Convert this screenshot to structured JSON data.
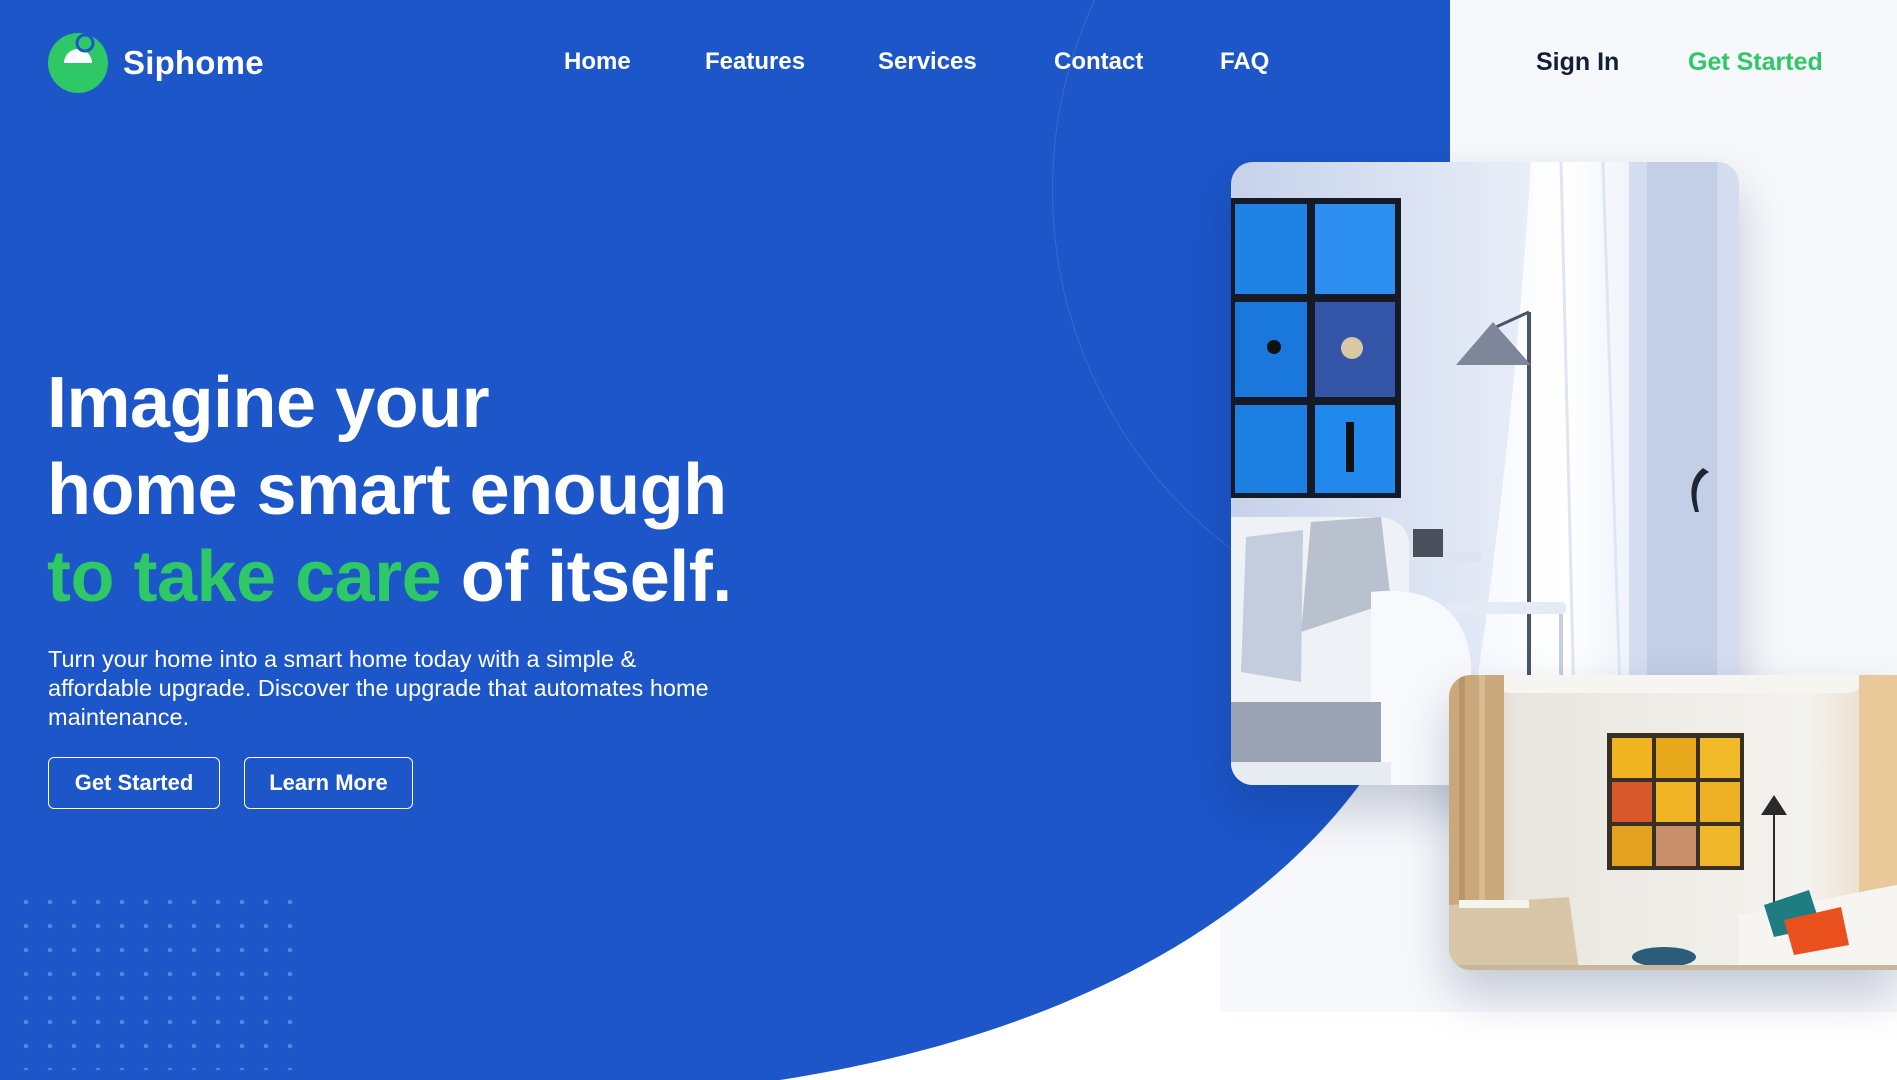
{
  "brand": {
    "name": "Siphome",
    "logo_icon": "half-circle-logo-icon"
  },
  "nav": {
    "links": [
      {
        "label": "Home"
      },
      {
        "label": "Features"
      },
      {
        "label": "Services"
      },
      {
        "label": "Contact"
      },
      {
        "label": "FAQ"
      }
    ],
    "sign_in": "Sign In",
    "get_started": "Get Started"
  },
  "hero": {
    "headline_line1": "Imagine your",
    "headline_line2": "home smart enough",
    "headline_accent": "to take care",
    "headline_end": " of itself.",
    "subtext": "Turn your home into a smart home today with a simple & affordable upgrade. Discover the upgrade that automates home maintenance.",
    "primary_button": "Get Started",
    "secondary_button": "Learn More"
  },
  "images": {
    "main": "living-room-photo",
    "secondary": "bright-room-photo"
  },
  "colors": {
    "primary_blue": "#1c56c9",
    "accent_green": "#2ec866",
    "text_dark": "#141f35",
    "background": "#ffffff"
  }
}
